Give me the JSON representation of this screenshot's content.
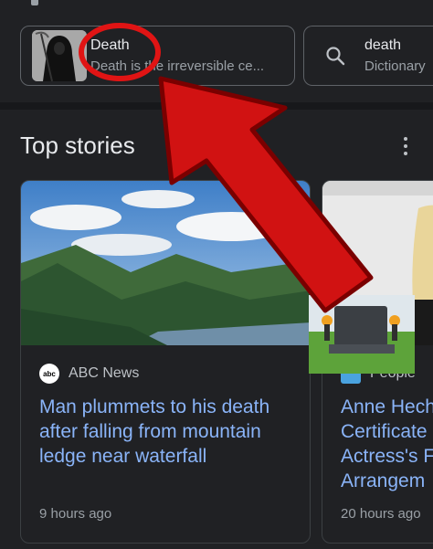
{
  "chips": [
    {
      "title": "Death",
      "subtitle": "Death is the irreversible ce..."
    },
    {
      "title": "death",
      "subtitle": "Dictionary"
    }
  ],
  "section": {
    "title": "Top stories"
  },
  "stories": [
    {
      "source": "ABC News",
      "source_logo_text": "abc",
      "headline": [
        "Man plummets to his death",
        "after falling from mountain",
        "ledge near waterfall"
      ],
      "time": "9 hours ago"
    },
    {
      "source": "People",
      "headline": [
        "Anne Heche",
        "Certificate",
        "Actress's F",
        "Arrangem"
      ],
      "time": "20 hours ago"
    }
  ],
  "colors": {
    "background": "#202124",
    "link": "#8ab4f8",
    "arrow": "#e01414",
    "circle": "#e01414"
  }
}
